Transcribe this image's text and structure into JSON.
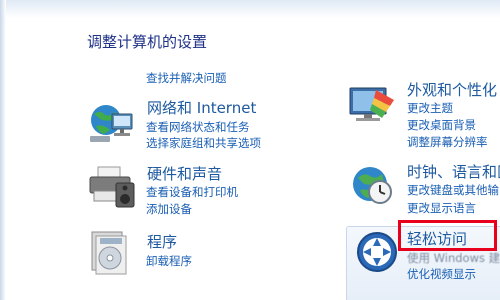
{
  "heading": "调整计算机的设置",
  "categories": {
    "system_security": {
      "links": [
        "查找并解决问题"
      ]
    },
    "network": {
      "title": "网络和 Internet",
      "links": [
        "查看网络状态和任务",
        "选择家庭组和共享选项"
      ]
    },
    "hardware": {
      "title": "硬件和声音",
      "links": [
        "查看设备和打印机",
        "添加设备"
      ]
    },
    "programs": {
      "title": "程序",
      "links": [
        "卸载程序"
      ]
    },
    "appearance": {
      "title": "外观和个性化",
      "links": [
        "更改主题",
        "更改桌面背景",
        "调整屏幕分辨率"
      ]
    },
    "clock": {
      "title": "时钟、语言和区",
      "links": [
        "更改键盘或其他输",
        "更改显示语言"
      ]
    },
    "ease": {
      "title": "轻松访问",
      "links": [
        "使用 Windows 建",
        "优化视频显示"
      ]
    }
  },
  "colors": {
    "highlight_border": "#e8001c",
    "link": "#1a5fb4",
    "title": "#1e3287"
  }
}
